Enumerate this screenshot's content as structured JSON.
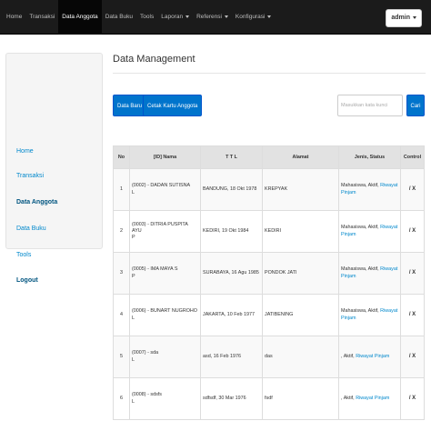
{
  "navbar": {
    "items": [
      {
        "label": "Home",
        "dropdown": false,
        "active": false
      },
      {
        "label": "Transaksi",
        "dropdown": false,
        "active": false
      },
      {
        "label": "Data Anggota",
        "dropdown": false,
        "active": true
      },
      {
        "label": "Data Buku",
        "dropdown": false,
        "active": false
      },
      {
        "label": "Tools",
        "dropdown": false,
        "active": false
      },
      {
        "label": "Laporan",
        "dropdown": true,
        "active": false
      },
      {
        "label": "Referensi",
        "dropdown": true,
        "active": false
      },
      {
        "label": "Konfigurasi",
        "dropdown": true,
        "active": false
      }
    ],
    "user_label": "admin"
  },
  "sidebar": {
    "items": [
      {
        "label": "Home",
        "active": false
      },
      {
        "label": "Transaksi",
        "active": false
      },
      {
        "label": "Data Anggota",
        "active": true
      },
      {
        "label": "Data Buku",
        "active": false
      },
      {
        "label": "Tools",
        "active": false
      },
      {
        "label": "Logout",
        "active": false
      }
    ]
  },
  "page": {
    "title": "Data Management"
  },
  "toolbar": {
    "data_baru": "Data Baru",
    "cetak": "Cetak Kartu Anggota",
    "search_placeholder": "Masukkan kata kunci",
    "search_button": "Cari"
  },
  "table": {
    "headers": [
      "No",
      "[ID] Nama",
      "T T L",
      "Alamat",
      "Jenis, Status",
      "Control"
    ],
    "rows": [
      {
        "no": "1",
        "name": "(0002) - DADAN SUTISNA",
        "gender": "L",
        "ttl": "BANDUNG, 18 Okt 1978",
        "alamat": "KREPYAK",
        "status": "Mahasiswa, Aktif,",
        "link": "Riwayat Pinjam",
        "control": "/ X"
      },
      {
        "no": "2",
        "name": "(0003) - DITRIA PUSPITA AYU",
        "gender": "P",
        "ttl": "KEDIRI, 19 Okt 1984",
        "alamat": "KEDIRI",
        "status": "Mahasiswa, Aktif,",
        "link": "Riwayat Pinjam",
        "control": "/ X"
      },
      {
        "no": "3",
        "name": "(0005) - IMA MAYA S",
        "gender": "P",
        "ttl": "SURABAYA, 16 Agu 1985",
        "alamat": "PONDOK JATI",
        "status": "Mahasiswa, Aktif,",
        "link": "Riwayat Pinjam",
        "control": "/ X"
      },
      {
        "no": "4",
        "name": "(0006) - BUNART NUGROHO",
        "gender": "L",
        "ttl": "JAKARTA, 10 Feb 1977",
        "alamat": "JATIBENING",
        "status": "Mahasiswa, Aktif,",
        "link": "Riwayat Pinjam",
        "control": "/ X"
      },
      {
        "no": "5",
        "name": "(0007) - sda",
        "gender": "L",
        "ttl": "asd, 16 Feb 1976",
        "alamat": "das",
        "status": ", Aktif,",
        "link": "Riwayat Pinjam",
        "control": "/ X"
      },
      {
        "no": "6",
        "name": "(0008) - sdsfs",
        "gender": "L",
        "ttl": "sdfsdf, 30 Mar 1976",
        "alamat": "fsdf",
        "status": ", Aktif,",
        "link": "Riwayat Pinjam",
        "control": "/ X"
      }
    ]
  }
}
